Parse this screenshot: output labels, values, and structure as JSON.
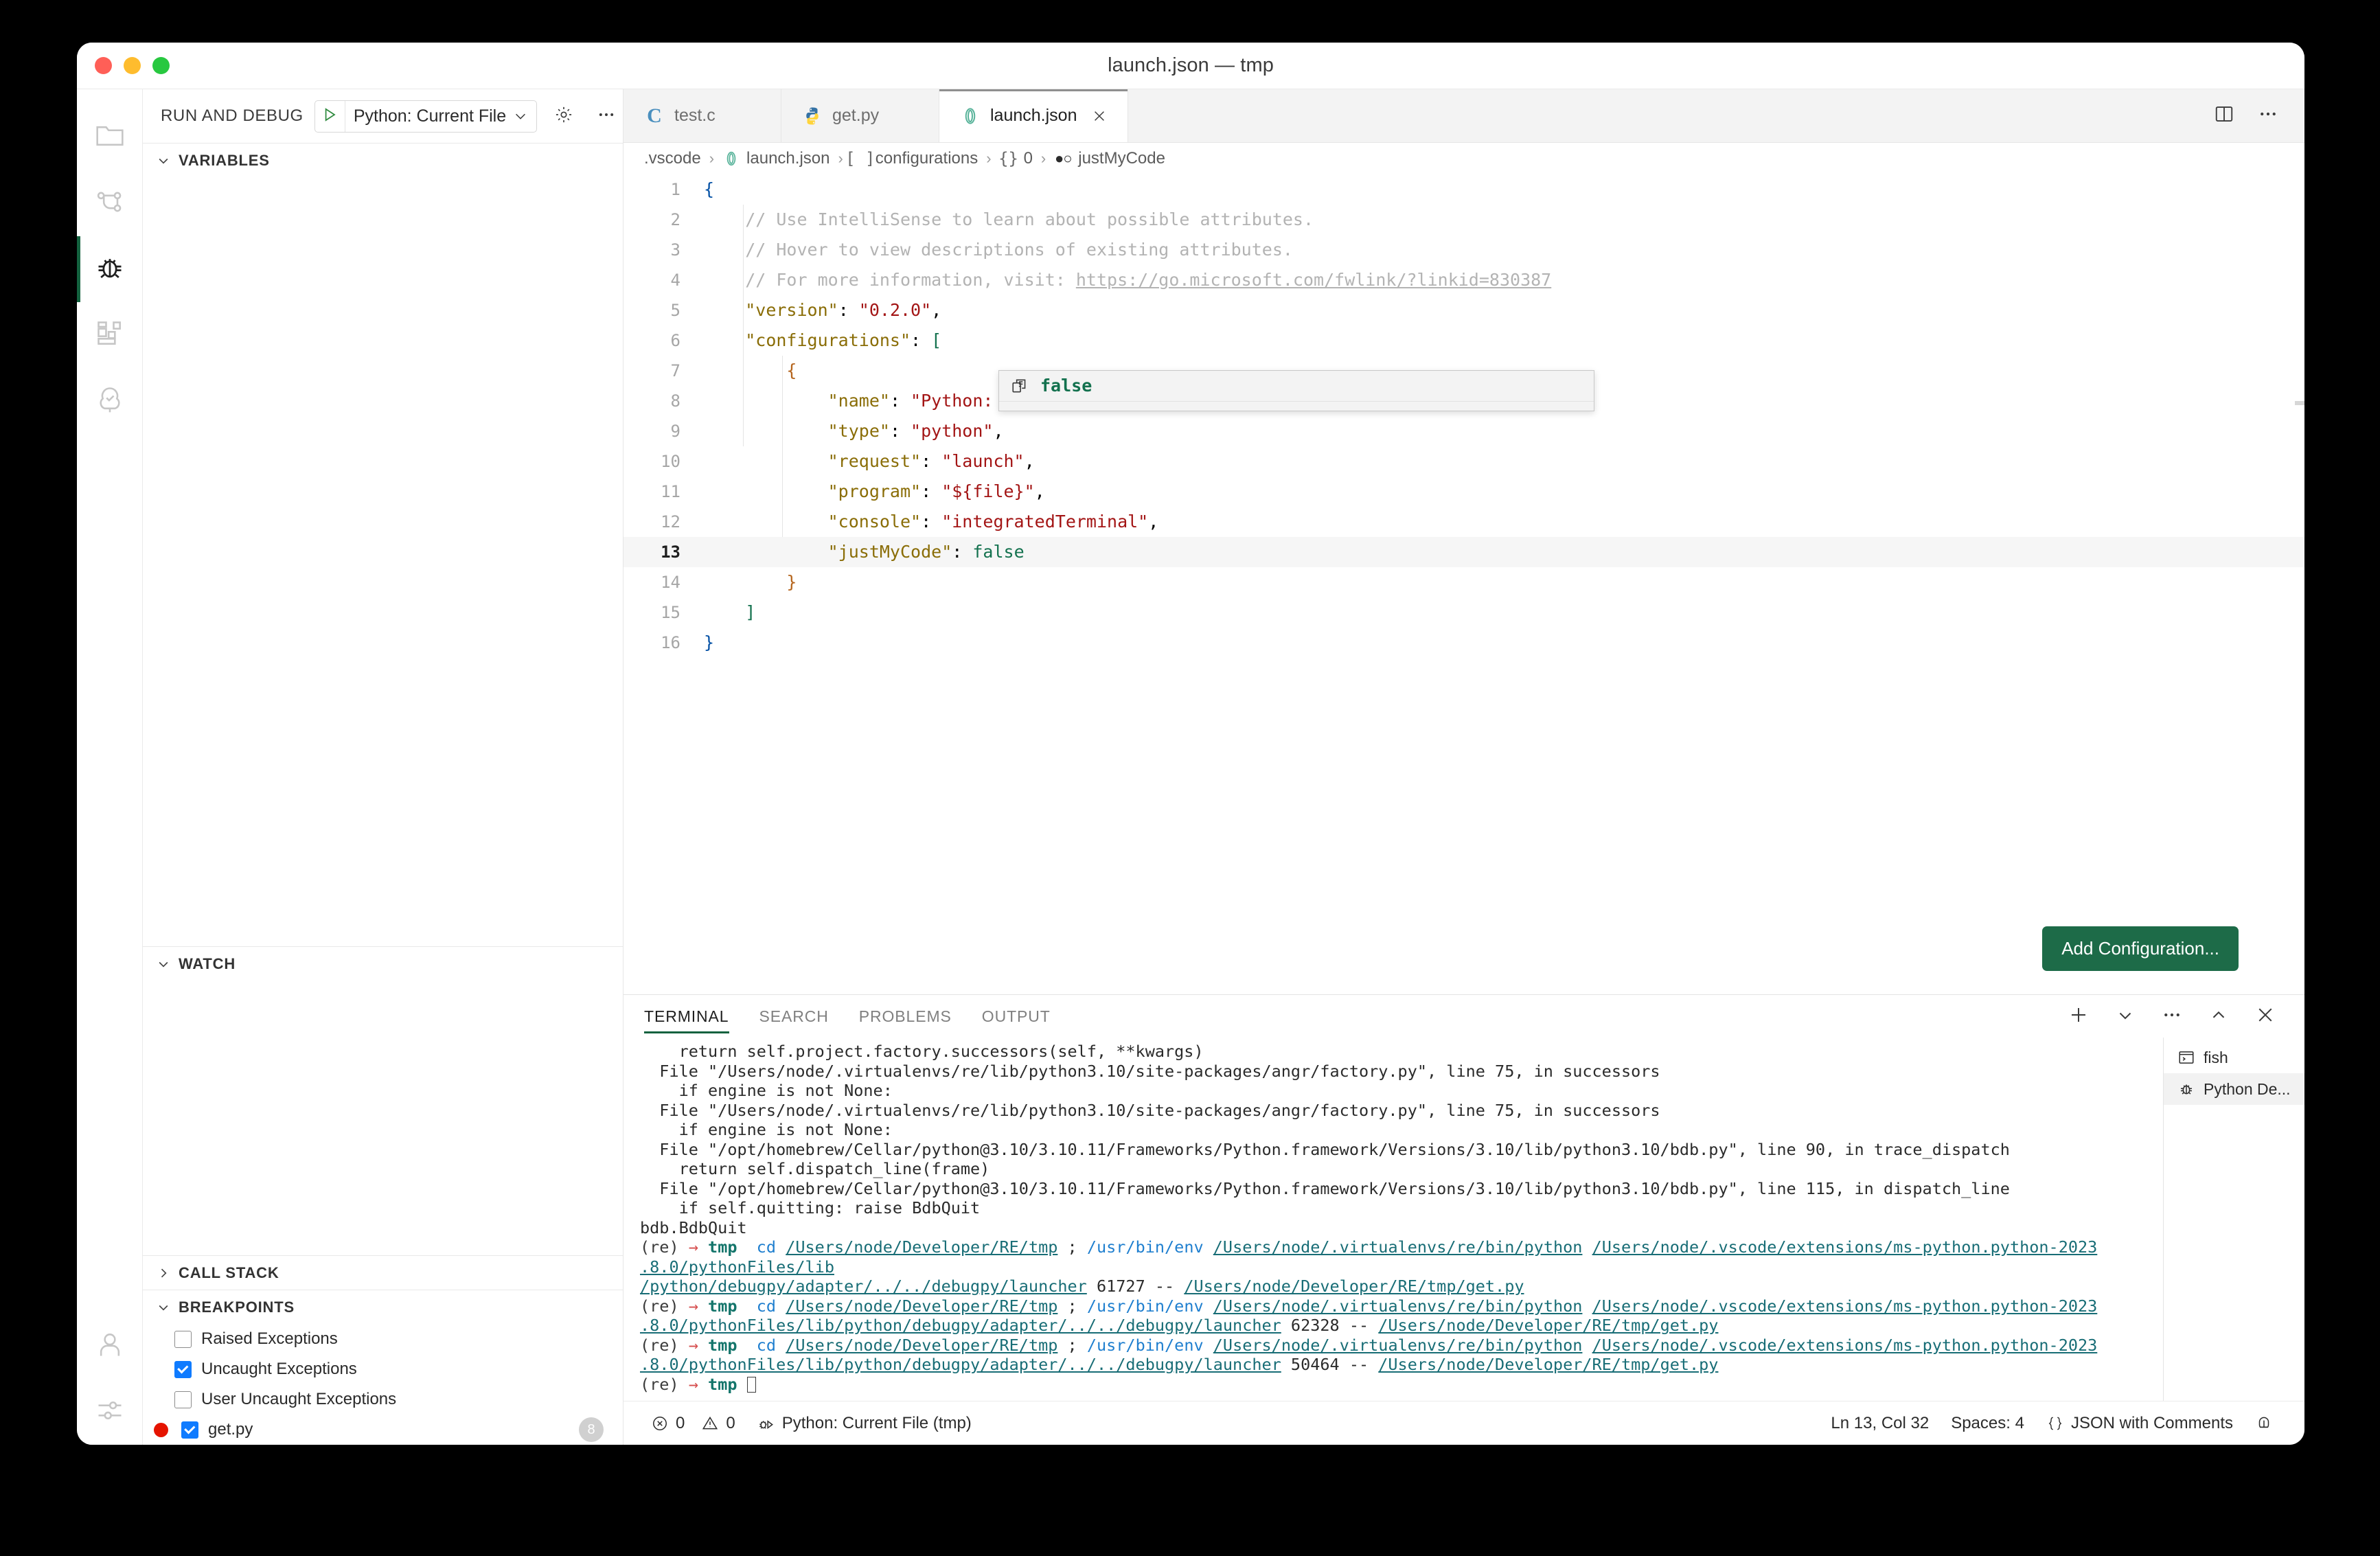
{
  "window": {
    "title": "launch.json — tmp",
    "traffic_lights": [
      "close-red",
      "minimize-yellow",
      "maximize-green"
    ]
  },
  "activity_bar": {
    "items": [
      {
        "name": "explorer",
        "icon": "folder-icon",
        "active": false
      },
      {
        "name": "source-control",
        "icon": "source-control-icon",
        "active": false
      },
      {
        "name": "run-and-debug",
        "icon": "bug-icon",
        "active": true
      },
      {
        "name": "extensions",
        "icon": "extensions-icon",
        "active": false
      },
      {
        "name": "testing",
        "icon": "tree-check-icon",
        "active": false
      }
    ],
    "bottom_items": [
      {
        "name": "accounts",
        "icon": "person-icon"
      },
      {
        "name": "manage-settings",
        "icon": "sliders-icon"
      }
    ]
  },
  "sidebar": {
    "title": "RUN AND DEBUG",
    "debug_config": "Python: Current File",
    "start_debug_icon": "play-icon",
    "caret_icon": "chevron-down-icon",
    "gear_icon": "gear-icon",
    "more_icon": "ellipsis-icon",
    "sections": {
      "variables": "VARIABLES",
      "watch": "WATCH",
      "call_stack": "CALL STACK",
      "breakpoints": "BREAKPOINTS"
    },
    "breakpoints": [
      {
        "label": "Raised Exceptions",
        "checked": false,
        "has_dot": false,
        "badge": ""
      },
      {
        "label": "Uncaught Exceptions",
        "checked": true,
        "has_dot": false,
        "badge": ""
      },
      {
        "label": "User Uncaught Exceptions",
        "checked": false,
        "has_dot": false,
        "badge": ""
      },
      {
        "label": "get.py",
        "checked": true,
        "has_dot": true,
        "badge": "8"
      }
    ]
  },
  "editor": {
    "tabs": [
      {
        "label": "test.c",
        "icon": "c-file-icon",
        "active": false,
        "closable": false
      },
      {
        "label": "get.py",
        "icon": "python-file-icon",
        "active": false,
        "closable": false
      },
      {
        "label": "launch.json",
        "icon": "json-file-icon",
        "active": true,
        "closable": true
      }
    ],
    "tab_actions": [
      {
        "name": "split-editor",
        "icon": "split-editor-icon"
      },
      {
        "name": "editor-more",
        "icon": "ellipsis-icon"
      }
    ],
    "breadcrumb": [
      {
        "label": ".vscode",
        "icon": ""
      },
      {
        "label": "launch.json",
        "icon": "json-file-icon"
      },
      {
        "label": "configurations",
        "icon": "array-bracket-icon"
      },
      {
        "label": "0",
        "icon": "object-brace-icon"
      },
      {
        "label": "justMyCode",
        "icon": "boolean-icon"
      }
    ],
    "add_configuration_label": "Add Configuration...",
    "suggestion": {
      "icon": "value-snippet-icon",
      "label": "false"
    },
    "code_lines": [
      {
        "n": "1",
        "tokens": [
          {
            "t": "{",
            "c": "punc"
          }
        ]
      },
      {
        "n": "2",
        "tokens": [
          {
            "t": "    // Use IntelliSense to learn about possible attributes.",
            "c": "com"
          }
        ]
      },
      {
        "n": "3",
        "tokens": [
          {
            "t": "    // Hover to view descriptions of existing attributes.",
            "c": "com"
          }
        ]
      },
      {
        "n": "4",
        "tokens": [
          {
            "t": "    // For more information, visit: ",
            "c": "com"
          },
          {
            "t": "https://go.microsoft.com/fwlink/?linkid=830387",
            "c": "link"
          }
        ]
      },
      {
        "n": "5",
        "tokens": [
          {
            "t": "    ",
            "c": "plain"
          },
          {
            "t": "\"version\"",
            "c": "key"
          },
          {
            "t": ": ",
            "c": "plain"
          },
          {
            "t": "\"0.2.0\"",
            "c": "str"
          },
          {
            "t": ",",
            "c": "plain"
          }
        ]
      },
      {
        "n": "6",
        "tokens": [
          {
            "t": "    ",
            "c": "plain"
          },
          {
            "t": "\"configurations\"",
            "c": "key"
          },
          {
            "t": ": ",
            "c": "plain"
          },
          {
            "t": "[",
            "c": "brk-green"
          }
        ]
      },
      {
        "n": "7",
        "tokens": [
          {
            "t": "        ",
            "c": "plain"
          },
          {
            "t": "{",
            "c": "brk"
          }
        ]
      },
      {
        "n": "8",
        "tokens": [
          {
            "t": "            ",
            "c": "plain"
          },
          {
            "t": "\"name\"",
            "c": "key"
          },
          {
            "t": ": ",
            "c": "plain"
          },
          {
            "t": "\"Python: Current File\"",
            "c": "str"
          },
          {
            "t": ",",
            "c": "plain"
          }
        ]
      },
      {
        "n": "9",
        "tokens": [
          {
            "t": "            ",
            "c": "plain"
          },
          {
            "t": "\"type\"",
            "c": "key"
          },
          {
            "t": ": ",
            "c": "plain"
          },
          {
            "t": "\"python\"",
            "c": "str"
          },
          {
            "t": ",",
            "c": "plain"
          }
        ]
      },
      {
        "n": "10",
        "tokens": [
          {
            "t": "            ",
            "c": "plain"
          },
          {
            "t": "\"request\"",
            "c": "key"
          },
          {
            "t": ": ",
            "c": "plain"
          },
          {
            "t": "\"launch\"",
            "c": "str"
          },
          {
            "t": ",",
            "c": "plain"
          }
        ]
      },
      {
        "n": "11",
        "tokens": [
          {
            "t": "            ",
            "c": "plain"
          },
          {
            "t": "\"program\"",
            "c": "key"
          },
          {
            "t": ": ",
            "c": "plain"
          },
          {
            "t": "\"${file}\"",
            "c": "str"
          },
          {
            "t": ",",
            "c": "plain"
          }
        ]
      },
      {
        "n": "12",
        "tokens": [
          {
            "t": "            ",
            "c": "plain"
          },
          {
            "t": "\"console\"",
            "c": "key"
          },
          {
            "t": ": ",
            "c": "plain"
          },
          {
            "t": "\"integratedTerminal\"",
            "c": "str"
          },
          {
            "t": ",",
            "c": "plain"
          }
        ]
      },
      {
        "n": "13",
        "current": true,
        "tokens": [
          {
            "t": "            ",
            "c": "plain"
          },
          {
            "t": "\"justMyCode\"",
            "c": "key"
          },
          {
            "t": ": ",
            "c": "plain"
          },
          {
            "t": "false",
            "c": "bool"
          }
        ]
      },
      {
        "n": "14",
        "tokens": [
          {
            "t": "        ",
            "c": "plain"
          },
          {
            "t": "}",
            "c": "brk"
          }
        ]
      },
      {
        "n": "15",
        "tokens": [
          {
            "t": "    ",
            "c": "plain"
          },
          {
            "t": "]",
            "c": "brk-green"
          }
        ]
      },
      {
        "n": "16",
        "tokens": [
          {
            "t": "}",
            "c": "punc"
          }
        ]
      }
    ]
  },
  "panel": {
    "tabs": [
      {
        "label": "TERMINAL",
        "active": true
      },
      {
        "label": "SEARCH",
        "active": false
      },
      {
        "label": "PROBLEMS",
        "active": false
      },
      {
        "label": "OUTPUT",
        "active": false
      }
    ],
    "actions": [
      {
        "name": "new-terminal",
        "icon": "plus-icon"
      },
      {
        "name": "terminal-profile-dropdown",
        "icon": "chevron-down-icon"
      },
      {
        "name": "panel-more",
        "icon": "ellipsis-icon"
      },
      {
        "name": "maximize-panel",
        "icon": "chevron-up-icon"
      },
      {
        "name": "close-panel",
        "icon": "close-icon"
      }
    ],
    "terminal_tabs": [
      {
        "label": "fish",
        "icon": "terminal-icon",
        "active": false
      },
      {
        "label": "Python De...",
        "icon": "bug-icon",
        "active": true
      }
    ],
    "terminal_lines": [
      [
        {
          "t": "    return self.project.factory.successors(self, **kwargs)",
          "c": "plain"
        }
      ],
      [
        {
          "t": "  File \"/Users/node/.virtualenvs/re/lib/python3.10/site-packages/angr/factory.py\", line 75, in successors",
          "c": "plain"
        }
      ],
      [
        {
          "t": "    if engine is not None:",
          "c": "plain"
        }
      ],
      [
        {
          "t": "  File \"/Users/node/.virtualenvs/re/lib/python3.10/site-packages/angr/factory.py\", line 75, in successors",
          "c": "plain"
        }
      ],
      [
        {
          "t": "    if engine is not None:",
          "c": "plain"
        }
      ],
      [
        {
          "t": "  File \"/opt/homebrew/Cellar/python@3.10/3.10.11/Frameworks/Python.framework/Versions/3.10/lib/python3.10/bdb.py\", line 90, in trace_dispatch",
          "c": "plain"
        }
      ],
      [
        {
          "t": "    return self.dispatch_line(frame)",
          "c": "plain"
        }
      ],
      [
        {
          "t": "  File \"/opt/homebrew/Cellar/python@3.10/3.10.11/Frameworks/Python.framework/Versions/3.10/lib/python3.10/bdb.py\", line 115, in dispatch_line",
          "c": "plain"
        }
      ],
      [
        {
          "t": "    if self.quitting: raise BdbQuit",
          "c": "plain"
        }
      ],
      [
        {
          "t": "bdb.BdbQuit",
          "c": "plain"
        }
      ],
      [
        {
          "t": "(re) ",
          "c": "prompt"
        },
        {
          "t": "→ ",
          "c": "arrow"
        },
        {
          "t": "tmp ",
          "c": "cwd"
        },
        {
          "t": " cd ",
          "c": "cmd"
        },
        {
          "t": "/Users/node/Developer/RE/tmp",
          "c": "path"
        },
        {
          "t": " ; ",
          "c": "plain"
        },
        {
          "t": "/usr/bin/env ",
          "c": "cmd"
        },
        {
          "t": "/Users/node/.virtualenvs/re/bin/python",
          "c": "path"
        },
        {
          "t": " ",
          "c": "plain"
        },
        {
          "t": "/Users/node/.vscode/extensions/ms-python.python-2023",
          "c": "path"
        }
      ],
      [
        {
          "t": ".8.0/pythonFiles/lib",
          "c": "path"
        }
      ],
      [
        {
          "t": "/python/debugpy/adapter/../../debugpy/launcher",
          "c": "path"
        },
        {
          "t": " 61727 -- ",
          "c": "plain"
        },
        {
          "t": "/Users/node/Developer/RE/tmp/get.py",
          "c": "path"
        }
      ],
      [
        {
          "t": "(re) ",
          "c": "prompt"
        },
        {
          "t": "→ ",
          "c": "arrow"
        },
        {
          "t": "tmp ",
          "c": "cwd"
        },
        {
          "t": " cd ",
          "c": "cmd"
        },
        {
          "t": "/Users/node/Developer/RE/tmp",
          "c": "path"
        },
        {
          "t": " ; ",
          "c": "plain"
        },
        {
          "t": "/usr/bin/env ",
          "c": "cmd"
        },
        {
          "t": "/Users/node/.virtualenvs/re/bin/python",
          "c": "path"
        },
        {
          "t": " ",
          "c": "plain"
        },
        {
          "t": "/Users/node/.vscode/extensions/ms-python.python-2023",
          "c": "path"
        }
      ],
      [
        {
          "t": ".8.0/pythonFiles/lib/python/debugpy/adapter/../../debugpy/launcher",
          "c": "path"
        },
        {
          "t": " 62328 -- ",
          "c": "plain"
        },
        {
          "t": "/Users/node/Developer/RE/tmp/get.py",
          "c": "path"
        }
      ],
      [
        {
          "t": "(re) ",
          "c": "prompt"
        },
        {
          "t": "→ ",
          "c": "arrow"
        },
        {
          "t": "tmp ",
          "c": "cwd"
        },
        {
          "t": " cd ",
          "c": "cmd"
        },
        {
          "t": "/Users/node/Developer/RE/tmp",
          "c": "path"
        },
        {
          "t": " ; ",
          "c": "plain"
        },
        {
          "t": "/usr/bin/env ",
          "c": "cmd"
        },
        {
          "t": "/Users/node/.virtualenvs/re/bin/python",
          "c": "path"
        },
        {
          "t": " ",
          "c": "plain"
        },
        {
          "t": "/Users/node/.vscode/extensions/ms-python.python-2023",
          "c": "path"
        }
      ],
      [
        {
          "t": ".8.0/pythonFiles/lib/python/debugpy/adapter/../../debugpy/launcher",
          "c": "path"
        },
        {
          "t": " 50464 -- ",
          "c": "plain"
        },
        {
          "t": "/Users/node/Developer/RE/tmp/get.py",
          "c": "path"
        }
      ],
      [
        {
          "t": "(re) ",
          "c": "prompt"
        },
        {
          "t": "→ ",
          "c": "arrow"
        },
        {
          "t": "tmp ",
          "c": "cwd"
        },
        {
          "t": "",
          "c": "cursor"
        }
      ]
    ]
  },
  "status_bar": {
    "left": [
      {
        "name": "problems",
        "icon": "error-icon",
        "label": "0"
      },
      {
        "name": "warnings",
        "icon": "warning-icon",
        "label": "0"
      },
      {
        "name": "debug-launch",
        "icon": "debug-alt-icon",
        "label": "Python: Current File (tmp)"
      }
    ],
    "right": [
      {
        "name": "cursor-position",
        "icon": "",
        "label": "Ln 13, Col 32"
      },
      {
        "name": "indentation",
        "icon": "",
        "label": "Spaces: 4"
      },
      {
        "name": "language-mode",
        "icon": "braces-icon",
        "label": "JSON with Comments"
      },
      {
        "name": "remote-or-bell",
        "icon": "bell-icon",
        "label": ""
      }
    ]
  },
  "colors": {
    "accent_green": "#1d6b48",
    "activity_active": "#14623f",
    "checkbox_blue": "#0f7bff",
    "breakpoint_red": "#e51400",
    "json_key": "#8a6d07",
    "json_string": "#a31515",
    "json_bool": "#13714e",
    "comment_gray": "#b3b3b3",
    "terminal_link": "#186d76",
    "terminal_cwd": "#14756b"
  }
}
